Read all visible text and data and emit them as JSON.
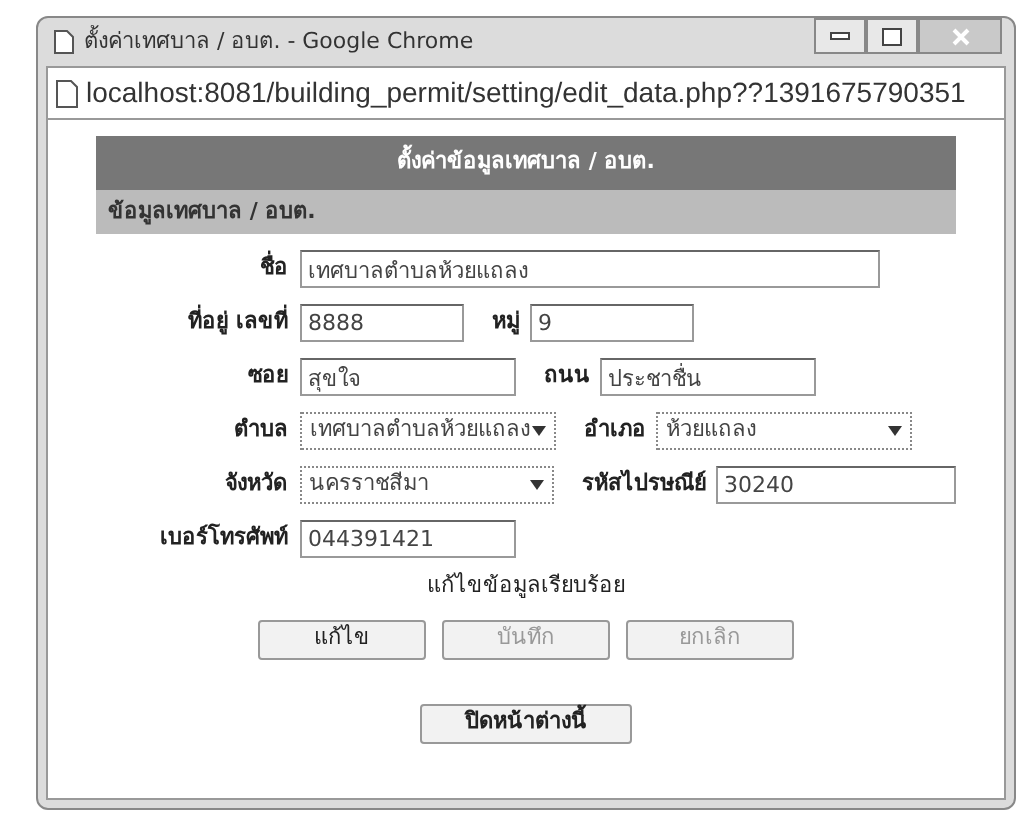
{
  "window": {
    "title": "ตั้งค่าเทศบาล / อบต. - Google Chrome",
    "url": "localhost:8081/building_permit/setting/edit_data.php??1391675790351"
  },
  "header": "ตั้งค่าข้อมูลเทศบาล / อบต.",
  "section_title": "ข้อมูลเทศบาล / อบต.",
  "rows": [
    {
      "fields": [
        {
          "label": "ชื่อ",
          "kind": "text",
          "value": "เทศบาลตำบลห้วยแถลง"
        }
      ]
    },
    {
      "fields": [
        {
          "label": "ที่อยู่ เลขที่",
          "kind": "text",
          "value": "8888"
        },
        {
          "label": "หมู่",
          "kind": "text",
          "value": "9"
        }
      ]
    },
    {
      "fields": [
        {
          "label": "ซอย",
          "kind": "text",
          "value": "สุขใจ"
        },
        {
          "label": "ถนน",
          "kind": "text",
          "value": "ประชาชื่น"
        }
      ]
    },
    {
      "fields": [
        {
          "label": "ตำบล",
          "kind": "select",
          "value": "เทศบาลตำบลห้วยแถลง"
        },
        {
          "label": "อำเภอ",
          "kind": "select",
          "value": "ห้วยแถลง"
        }
      ]
    },
    {
      "fields": [
        {
          "label": "จังหวัด",
          "kind": "select",
          "value": "นครราชสีมา"
        },
        {
          "label": "รหัสไปรษณีย์",
          "kind": "text",
          "value": "30240"
        }
      ]
    },
    {
      "fields": [
        {
          "label": "เบอร์โทรศัพท์",
          "kind": "text",
          "value": "044391421"
        }
      ]
    }
  ],
  "message": "แก้ไขข้อมูลเรียบร้อย",
  "buttons": [
    {
      "label": "แก้ไข",
      "disabled": false
    },
    {
      "label": "บันทึก",
      "disabled": true
    },
    {
      "label": "ยกเลิก",
      "disabled": true
    }
  ],
  "close_button": {
    "label": "ปิดหน้าต่างนี้"
  }
}
